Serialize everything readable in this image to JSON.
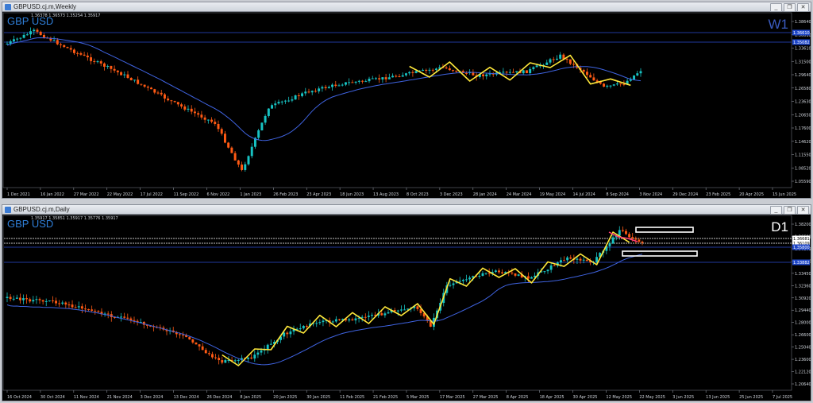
{
  "weekly": {
    "title": "GBPUSD.cj.m,Weekly",
    "ohlc": "1.36378 1.36573 1.35254 1.35917",
    "symbol_label": "GBP USD",
    "timeframe_label": "W1",
    "timeframe_color": "#3a5bbf",
    "price_labels": [
      "1.38640",
      "1.36610",
      "1.33610",
      "1.31500",
      "1.29640",
      "1.26580",
      "1.23630",
      "1.20650",
      "1.17600",
      "1.14620",
      "1.11550",
      "1.08520",
      "1.05590"
    ],
    "tags": [
      {
        "text": "1.36610",
        "bg": "#1f47c9"
      },
      {
        "text": "1.35082",
        "bg": "#1f47c9"
      }
    ],
    "date_labels": [
      "1 Dec 2021",
      "16 Jan 2022",
      "27 Mar 2022",
      "22 May 2022",
      "17 Jul 2022",
      "11 Sep 2022",
      "6 Nov 2022",
      "1 Jan 2023",
      "26 Feb 2023",
      "23 Apr 2023",
      "18 Jun 2023",
      "13 Aug 2023",
      "8 Oct 2023",
      "3 Dec 2023",
      "28 Jan 2024",
      "24 Mar 2024",
      "19 May 2024",
      "14 Jul 2024",
      "8 Sep 2024",
      "3 Nov 2024",
      "29 Dec 2024",
      "23 Feb 2025",
      "20 Apr 2025",
      "15 Jun 2025"
    ]
  },
  "daily": {
    "title": "GBPUSD.cj.m,Daily",
    "ohlc": "1.35917 1.35851 1.35917 1.35776 1.35917",
    "symbol_label": "GBP USD",
    "timeframe_label": "D1",
    "timeframe_color": "#ffffff",
    "price_labels": [
      "1.38200",
      "1.36681",
      "1.36109",
      "1.35800",
      "1.33450",
      "1.32360",
      "1.30920",
      "1.29440",
      "1.28000",
      "1.26600",
      "1.25040",
      "1.23600",
      "1.22120",
      "1.20640"
    ],
    "tags": [
      {
        "text": "1.36681",
        "bg": "#ffffff"
      },
      {
        "text": "1.36109",
        "bg": "#ffffff"
      },
      {
        "text": "1.35800",
        "bg": "#1f47c9"
      },
      {
        "text": "1.33882",
        "bg": "#1f47c9"
      }
    ],
    "date_labels": [
      "16 Oct 2024",
      "30 Oct 2024",
      "11 Nov 2024",
      "21 Nov 2024",
      "3 Dec 2024",
      "13 Dec 2024",
      "26 Dec 2024",
      "8 Jan 2025",
      "20 Jan 2025",
      "30 Jan 2025",
      "11 Feb 2025",
      "21 Feb 2025",
      "5 Mar 2025",
      "17 Mar 2025",
      "27 Mar 2025",
      "8 Apr 2025",
      "18 Apr 2025",
      "30 Apr 2025",
      "12 May 2025",
      "22 May 2025",
      "3 Jun 2025",
      "13 Jun 2025",
      "25 Jun 2025",
      "7 Jul 2025"
    ]
  },
  "window_buttons": [
    "_",
    "❐",
    "✕"
  ],
  "colors": {
    "bull": "#17c3c3",
    "bear": "#ff5a14",
    "ma": "#3f63e0",
    "zigzag": "#ffe83a",
    "level": "#2d4bd0"
  }
}
